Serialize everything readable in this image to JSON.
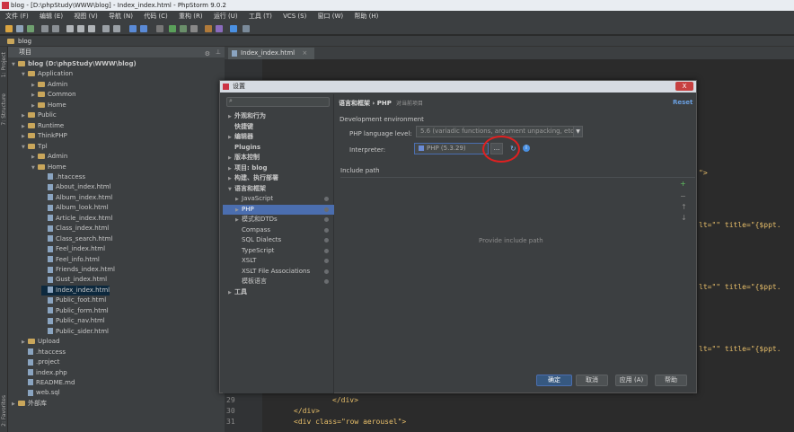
{
  "window": {
    "title": "blog - [D:\\phpStudy\\WWW\\blog] - Index_index.html - PhpStorm 9.0.2"
  },
  "menu": [
    "文件 (F)",
    "编辑 (E)",
    "视图 (V)",
    "导航 (N)",
    "代码 (C)",
    "重构 (R)",
    "运行 (U)",
    "工具 (T)",
    "VCS (S)",
    "窗口 (W)",
    "帮助 (H)"
  ],
  "breadcrumb": "blog",
  "side_tabs": {
    "project": "1: Project",
    "structure": "7: Structure",
    "favorites": "2: Favorites"
  },
  "project": {
    "header": "项目",
    "tree": [
      {
        "label": "blog (D:\\phpStudy\\WWW\\blog)",
        "depth": 0,
        "kind": "folder",
        "open": true
      },
      {
        "label": "Application",
        "depth": 1,
        "kind": "folder",
        "open": true
      },
      {
        "label": "Admin",
        "depth": 2,
        "kind": "folder"
      },
      {
        "label": "Common",
        "depth": 2,
        "kind": "folder"
      },
      {
        "label": "Home",
        "depth": 2,
        "kind": "folder"
      },
      {
        "label": "Public",
        "depth": 1,
        "kind": "folder"
      },
      {
        "label": "Runtime",
        "depth": 1,
        "kind": "folder"
      },
      {
        "label": "ThinkPHP",
        "depth": 1,
        "kind": "folder"
      },
      {
        "label": "Tpl",
        "depth": 1,
        "kind": "folder",
        "open": true
      },
      {
        "label": "Admin",
        "depth": 2,
        "kind": "folder"
      },
      {
        "label": "Home",
        "depth": 2,
        "kind": "folder",
        "open": true
      },
      {
        "label": ".htaccess",
        "depth": 3,
        "kind": "file"
      },
      {
        "label": "About_index.html",
        "depth": 3,
        "kind": "file"
      },
      {
        "label": "Album_index.html",
        "depth": 3,
        "kind": "file"
      },
      {
        "label": "Album_look.html",
        "depth": 3,
        "kind": "file"
      },
      {
        "label": "Article_index.html",
        "depth": 3,
        "kind": "file"
      },
      {
        "label": "Class_index.html",
        "depth": 3,
        "kind": "file"
      },
      {
        "label": "Class_search.html",
        "depth": 3,
        "kind": "file"
      },
      {
        "label": "Feel_index.html",
        "depth": 3,
        "kind": "file"
      },
      {
        "label": "Feel_info.html",
        "depth": 3,
        "kind": "file"
      },
      {
        "label": "Friends_index.html",
        "depth": 3,
        "kind": "file"
      },
      {
        "label": "Gust_index.html",
        "depth": 3,
        "kind": "file"
      },
      {
        "label": "Index_index.html",
        "depth": 3,
        "kind": "file"
      },
      {
        "label": "Public_foot.html",
        "depth": 3,
        "kind": "file"
      },
      {
        "label": "Public_form.html",
        "depth": 3,
        "kind": "file"
      },
      {
        "label": "Public_nav.html",
        "depth": 3,
        "kind": "file"
      },
      {
        "label": "Public_sider.html",
        "depth": 3,
        "kind": "file"
      },
      {
        "label": "Upload",
        "depth": 1,
        "kind": "folder"
      },
      {
        "label": ".htaccess",
        "depth": 1,
        "kind": "file"
      },
      {
        "label": ".project",
        "depth": 1,
        "kind": "file"
      },
      {
        "label": "index.php",
        "depth": 1,
        "kind": "file"
      },
      {
        "label": "README.md",
        "depth": 1,
        "kind": "file"
      },
      {
        "label": "web.sql",
        "depth": 1,
        "kind": "file"
      },
      {
        "label": "外部库",
        "depth": 0,
        "kind": "folder"
      }
    ]
  },
  "editor": {
    "tab": "Index_index.html",
    "line_numbers": [
      "29",
      "30",
      "31"
    ],
    "code": [
      "</div>",
      "</div>",
      "<div class=\"row aerousel\">"
    ],
    "right_snippets": [
      "\">",
      "lt=\"\"  title=\"{$ppt.",
      "lt=\"\"  title=\"{$ppt.",
      "lt=\"\"  title=\"{$ppt."
    ]
  },
  "dialog": {
    "title": "设置",
    "close": "X",
    "nav": [
      {
        "label": "外观和行为",
        "depth": 0,
        "arrow": true
      },
      {
        "label": "快捷键",
        "depth": 0
      },
      {
        "label": "编辑器",
        "depth": 0,
        "arrow": true
      },
      {
        "label": "Plugins",
        "depth": 0
      },
      {
        "label": "版本控制",
        "depth": 0,
        "arrow": true
      },
      {
        "label": "项目: blog",
        "depth": 0,
        "arrow": true
      },
      {
        "label": "构建、执行部署",
        "depth": 0,
        "arrow": true
      },
      {
        "label": "语言和框架",
        "depth": 0,
        "arrow": true,
        "open": true
      },
      {
        "label": "JavaScript",
        "depth": 1,
        "arrow": true
      },
      {
        "label": "PHP",
        "depth": 1,
        "arrow": true,
        "selected": true
      },
      {
        "label": "模式和DTDs",
        "depth": 1,
        "arrow": true
      },
      {
        "label": "Compass",
        "depth": 1
      },
      {
        "label": "SQL Dialects",
        "depth": 1
      },
      {
        "label": "TypeScript",
        "depth": 1
      },
      {
        "label": "XSLT",
        "depth": 1
      },
      {
        "label": "XSLT File Associations",
        "depth": 1
      },
      {
        "label": "模板语言",
        "depth": 1
      },
      {
        "label": "工具",
        "depth": 0,
        "arrow": true
      }
    ],
    "breadcrumb": "语言和框架 › PHP",
    "scope_note": "对当前项目",
    "reset": "Reset",
    "section_title": "Development environment",
    "php_level_label": "PHP language level:",
    "php_level_value": "5.6 (variadic functions, argument unpacking, etc)",
    "interpreter_label": "Interpreter:",
    "interpreter_value": "PHP (5.3.29)",
    "dots": "...",
    "include_path_label": "Include path",
    "include_placeholder": "Provide include path",
    "buttons": {
      "ok": "确定",
      "cancel": "取消",
      "apply": "应用 (A)",
      "help": "帮助"
    }
  }
}
